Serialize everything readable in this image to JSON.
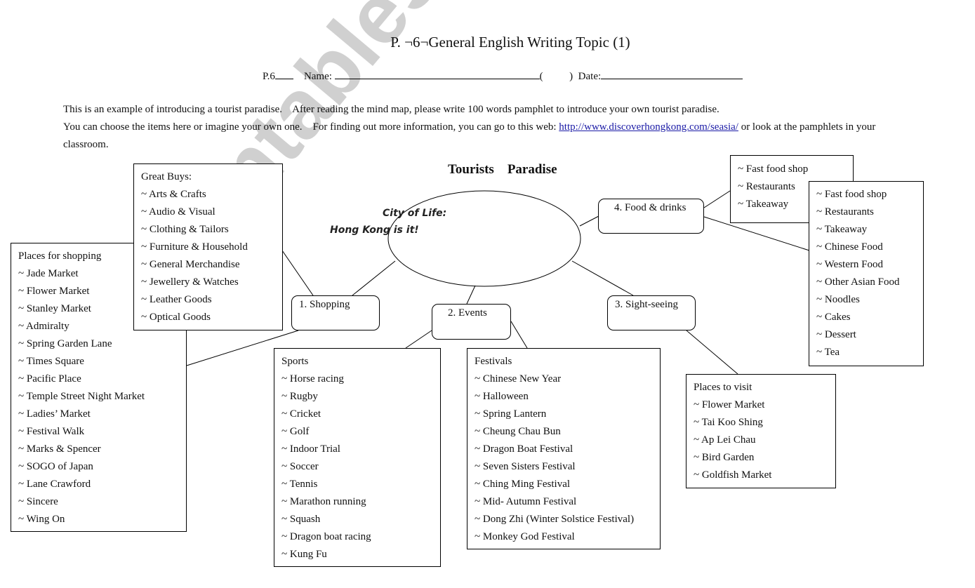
{
  "header": {
    "title": "P. ¬6¬General English Writing Topic (1)",
    "class_label": "P.6",
    "name_label": "Name:",
    "paren_open": "(",
    "paren_close": ")",
    "date_label": "Date:"
  },
  "instructions": {
    "line1": "This is an example of introducing a tourist paradise.    After reading the mind map, please write 100 words pamphlet to introduce your own tourist paradise.",
    "line2_before": "You can choose the items here or imagine your own one.    For finding out more information, you can go to this web: ",
    "link": "http://www.discoverhongkong.com/seasia/",
    "line2_after": " or look at the pamphlets in your",
    "line3": "classroom."
  },
  "mindmap": {
    "title": "Tourists    Paradise",
    "center": {
      "slogan1": "City of Life:",
      "slogan2": "Hong Kong is it!"
    },
    "nodes": {
      "shopping": "1. Shopping",
      "events": "2. Events",
      "sightseeing": "3. Sight-seeing",
      "food": "4. Food & drinks"
    },
    "great_buys": {
      "heading": "Great Buys:",
      "items": [
        "~ Arts & Crafts",
        "~ Audio & Visual",
        "~ Clothing & Tailors",
        "~ Furniture & Household",
        "~ General Merchandise",
        "~ Jewellery & Watches",
        "~ Leather Goods",
        "~ Optical Goods"
      ]
    },
    "places_for_shopping": {
      "heading": "Places for shopping",
      "items": [
        "~ Jade Market",
        "~ Flower Market",
        "~ Stanley Market",
        "~ Admiralty",
        "~ Spring Garden Lane",
        "~ Times Square",
        "~ Pacific Place",
        "~ Temple Street Night Market",
        "~ Ladies’ Market",
        "~ Festival Walk",
        "~ Marks & Spencer",
        "~ SOGO of Japan",
        "~ Lane Crawford",
        "~ Sincere",
        "~ Wing On"
      ]
    },
    "sports": {
      "heading": "Sports",
      "items": [
        "~ Horse racing",
        "~ Rugby",
        "~ Cricket",
        "~ Golf",
        "~ Indoor Trial",
        "~ Soccer",
        "~ Tennis",
        "~ Marathon running",
        "~ Squash",
        "~ Dragon boat racing",
        "~ Kung Fu"
      ]
    },
    "festivals": {
      "heading": "Festivals",
      "items": [
        "~ Chinese New Year",
        "~ Halloween",
        "~ Spring Lantern",
        "~ Cheung Chau Bun",
        "~ Dragon Boat Festival",
        "~ Seven Sisters Festival",
        "~ Ching Ming Festival",
        "~ Mid- Autumn Festival",
        "~ Dong Zhi (Winter Solstice Festival)",
        "~ Monkey God Festival"
      ]
    },
    "places_to_visit": {
      "heading": "Places to visit",
      "items": [
        "~ Flower Market",
        "~ Tai Koo Shing",
        "~ Ap Lei Chau",
        "~ Bird Garden",
        "~ Goldfish Market"
      ]
    },
    "food_small": {
      "items": [
        "~ Fast food shop",
        "~ Restaurants",
        "~ Takeaway"
      ]
    },
    "food_large": {
      "items": [
        "~ Fast food shop",
        "~ Restaurants",
        "~ Takeaway",
        "~ Chinese Food",
        "~ Western Food",
        "~ Other Asian Food",
        "~ Noodles",
        "~ Cakes",
        "~ Dessert",
        "~ Tea"
      ]
    }
  },
  "watermark": "ESLprintables.com"
}
